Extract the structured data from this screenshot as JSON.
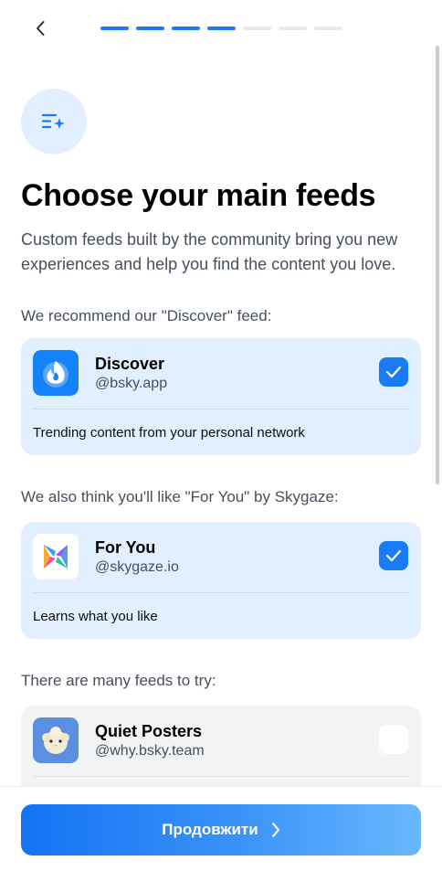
{
  "header": {
    "back_icon": "chevron-left-icon",
    "progress": {
      "total_steps": 7,
      "completed_steps": 4
    }
  },
  "hero_icon": "sparkle-list-icon",
  "title": "Choose your main feeds",
  "description": "Custom feeds built by the community bring you new experiences and help you find the content you love.",
  "sections": {
    "recommend_label": "We recommend our \"Discover\" feed:",
    "also_like_label": "We also think you'll like \"For You\" by Skygaze:",
    "many_feeds_label": "There are many feeds to try:"
  },
  "feeds": [
    {
      "name": "Discover",
      "handle": "@bsky.app",
      "description": "Trending content from your personal network",
      "checked": true,
      "avatar_icon": "bluesky-flame-icon"
    },
    {
      "name": "For You",
      "handle": "@skygaze.io",
      "description": "Learns what you like",
      "checked": true,
      "avatar_icon": "skygaze-logo-icon"
    },
    {
      "name": "Quiet Posters",
      "handle": "@why.bsky.team",
      "description": "",
      "checked": false,
      "avatar_icon": "fluffy-creature-icon"
    }
  ],
  "footer": {
    "continue_label": "Продовжити",
    "continue_icon": "chevron-right-icon"
  },
  "colors": {
    "accent": "#1a7cf5",
    "card_selected_bg": "#e2efff",
    "card_bg": "#f1f3f5",
    "muted_text": "#46505c"
  }
}
